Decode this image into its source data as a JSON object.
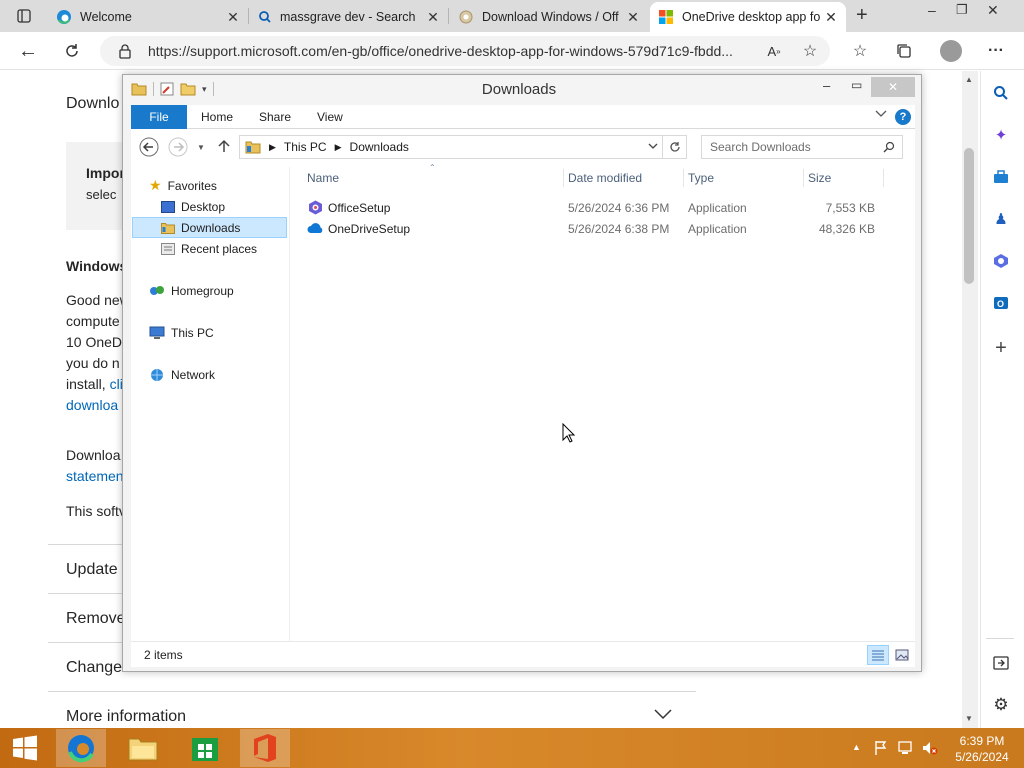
{
  "browser": {
    "tabs": [
      {
        "title": "Welcome",
        "icon": "edge-icon"
      },
      {
        "title": "massgrave dev - Search",
        "icon": "search-icon"
      },
      {
        "title": "Download Windows / Off",
        "icon": "gear-icon"
      },
      {
        "title": "OneDrive desktop app fo",
        "icon": "microsoft-logo-icon",
        "active": true
      }
    ],
    "new_tab": "+",
    "window_controls": {
      "minimize": "–",
      "restore": "❐",
      "close": "✕"
    },
    "url": "https://support.microsoft.com/en-gb/office/onedrive-desktop-app-for-windows-579d71c9-fbdd...",
    "more": "···"
  },
  "page": {
    "heading_partial": "Downlo",
    "notice_line1": "Impor",
    "notice_line2": "selec",
    "windows_heading": "Windows",
    "para_lines": [
      "Good new",
      "compute",
      "10 OneD",
      "you do n",
      "install, "
    ],
    "para_link1": "cli",
    "para_link2": "downloa",
    "download_line": "Downloa",
    "statement_link": "statemen",
    "software_line": "This softv",
    "accordions": [
      "Update",
      "Remove",
      "Change",
      "More information"
    ]
  },
  "explorer": {
    "title": "Downloads",
    "ribbon_tabs": [
      "File",
      "Home",
      "Share",
      "View"
    ],
    "path": [
      "This PC",
      "Downloads"
    ],
    "search_placeholder": "Search Downloads",
    "nav": {
      "favorites": "Favorites",
      "favorites_items": [
        "Desktop",
        "Downloads",
        "Recent places"
      ],
      "homegroup": "Homegroup",
      "this_pc": "This PC",
      "network": "Network"
    },
    "columns": {
      "name": "Name",
      "date": "Date modified",
      "type": "Type",
      "size": "Size"
    },
    "files": [
      {
        "name": "OfficeSetup",
        "date": "5/26/2024 6:36 PM",
        "type": "Application",
        "size": "7,553 KB",
        "icon": "office-setup-icon"
      },
      {
        "name": "OneDriveSetup",
        "date": "5/26/2024 6:38 PM",
        "type": "Application",
        "size": "48,326 KB",
        "icon": "onedrive-cloud-icon"
      }
    ],
    "status": "2 items"
  },
  "taskbar": {
    "time": "6:39 PM",
    "date": "5/26/2024"
  },
  "colors": {
    "file_tab": "#1979ca",
    "link": "#0067b8",
    "taskbar": "#c97a1e"
  }
}
